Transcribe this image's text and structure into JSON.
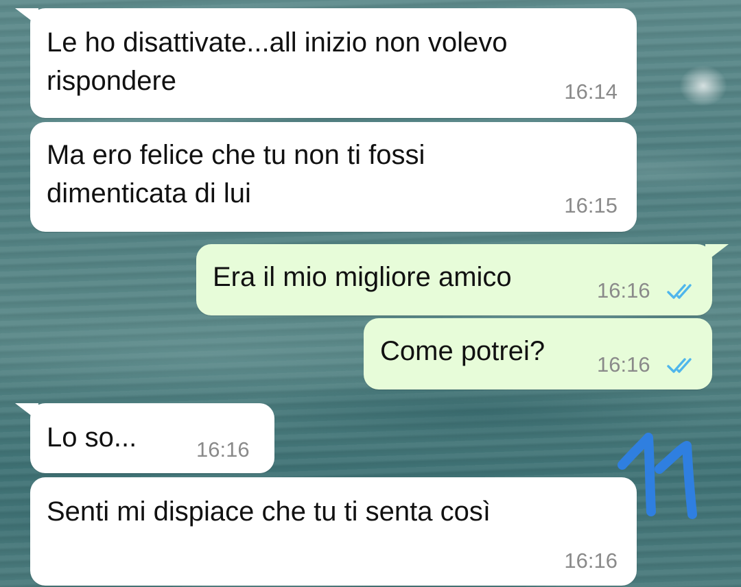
{
  "chat": {
    "messages": [
      {
        "direction": "incoming",
        "text_line1": "Le ho disattivate...all inizio non volevo",
        "text_line2": "rispondere",
        "time": "16:14"
      },
      {
        "direction": "incoming",
        "text_line1": "Ma ero felice che tu non ti fossi",
        "text_line2": "dimenticata di lui",
        "time": "16:15"
      },
      {
        "direction": "outgoing",
        "text": "Era il mio migliore amico",
        "time": "16:16",
        "status": "read",
        "status_icon": "double-check-icon"
      },
      {
        "direction": "outgoing",
        "text": "Come potrei?",
        "time": "16:16",
        "status": "read",
        "status_icon": "double-check-icon"
      },
      {
        "direction": "incoming",
        "text": "Lo so...",
        "time": "16:16"
      },
      {
        "direction": "incoming",
        "text": "Senti mi dispiace che tu ti senta così",
        "time": "16:16"
      }
    ]
  },
  "colors": {
    "incoming_bubble": "#ffffff",
    "outgoing_bubble": "#e7fcd9",
    "read_ticks": "#4fb6ec",
    "annotation": "#2f7fe0"
  },
  "annotation": {
    "icon": "handwritten-11-mark"
  }
}
